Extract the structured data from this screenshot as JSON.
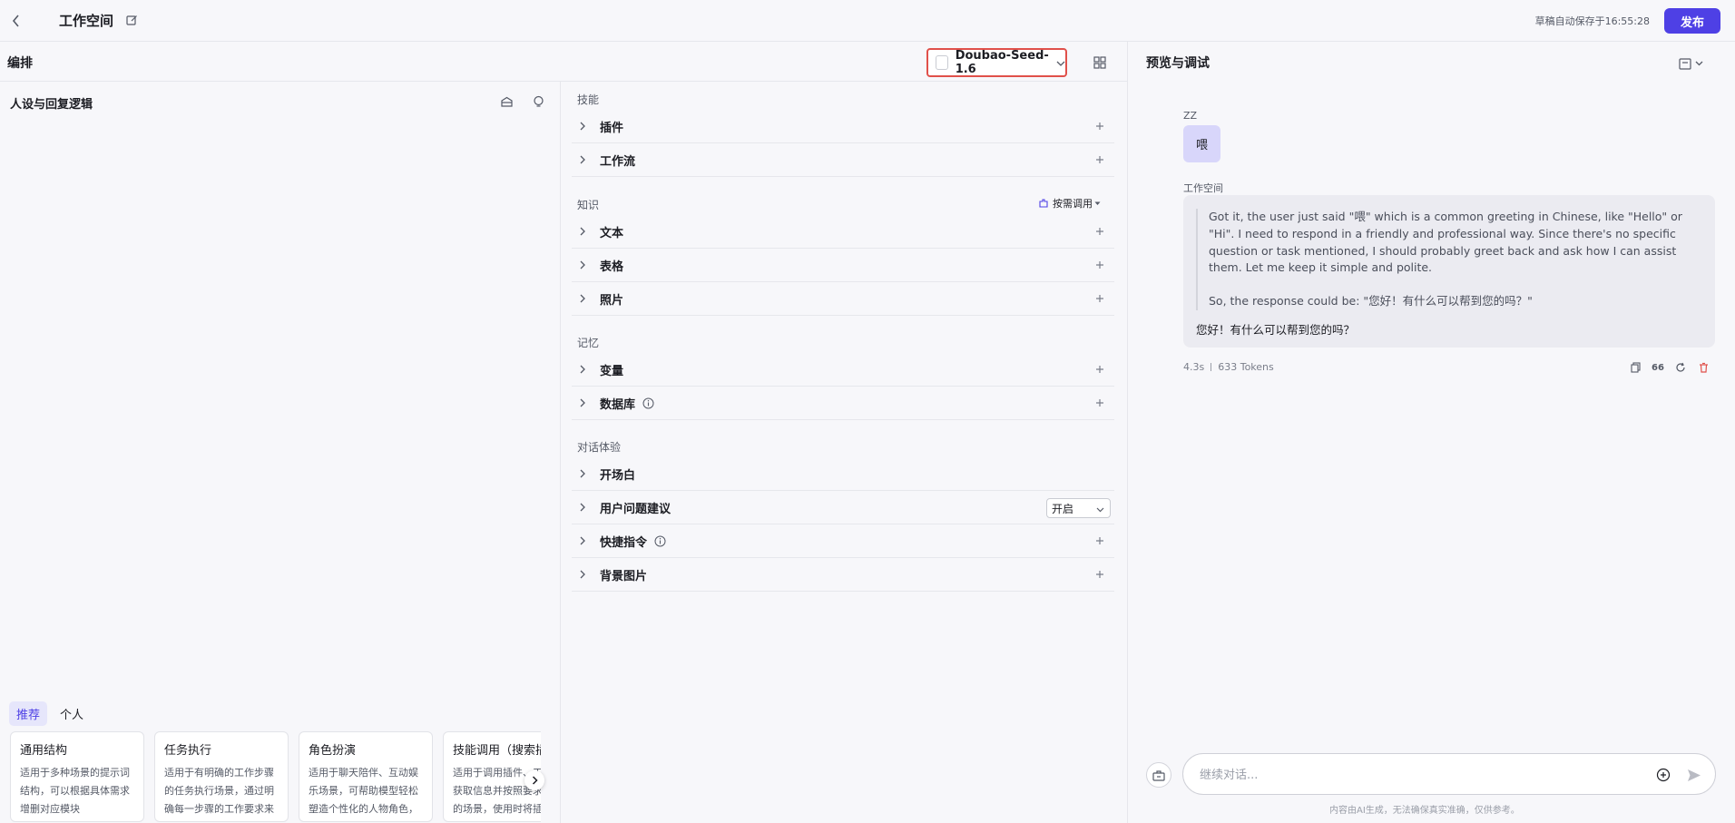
{
  "header": {
    "title": "工作空间",
    "autosave": "草稿自动保存于16:55:28",
    "publish_label": "发布"
  },
  "editor": {
    "title": "编排",
    "model_name": "Doubao-Seed-1.6"
  },
  "persona": {
    "title": "人设与回复逻辑"
  },
  "templates": {
    "tabs": [
      {
        "label": "推荐",
        "active": true
      },
      {
        "label": "个人",
        "active": false
      }
    ],
    "cards": [
      {
        "title": "通用结构",
        "desc": "适用于多种场景的提示词结构，可以根据具体需求增删对应模块"
      },
      {
        "title": "任务执行",
        "desc": "适用于有明确的工作步骤的任务执行场景，通过明确每一步骤的工作要求来指导模型完成复杂任务"
      },
      {
        "title": "角色扮演",
        "desc": "适用于聊天陪伴、互动娱乐场景，可帮助模型轻松塑造个性化的人物角色，生动演绎"
      },
      {
        "title": "技能调用（搜索插件）",
        "desc": "适用于调用插件、工作流获取信息并按照要求输出的场景，使用时将插件名称"
      }
    ]
  },
  "skills": {
    "section_skill": "技能",
    "plugin": "插件",
    "workflow": "工作流",
    "section_knowledge": "知识",
    "on_demand": "按需调用",
    "text": "文本",
    "table": "表格",
    "photo": "照片",
    "section_memory": "记忆",
    "variable": "变量",
    "database": "数据库",
    "section_chat": "对话体验",
    "opening": "开场白",
    "suggestion": "用户问题建议",
    "suggestion_value": "开启",
    "shortcut": "快捷指令",
    "background": "背景图片"
  },
  "preview": {
    "title": "预览与调试",
    "user_name": "ZZ",
    "user_message": "喂",
    "bot_name": "工作空间",
    "reasoning_1": "Got it, the user just said \"喂\" which is a common greeting in Chinese, like \"Hello\" or \"Hi\". I need to respond in a friendly and professional way. Since there's no specific question or task mentioned, I should probably greet back and ask how I can assist them. Let me keep it simple and polite.",
    "reasoning_2": "So, the response could be: \"您好！有什么可以帮到您的吗？\"",
    "answer": "您好！有什么可以帮到您的吗？",
    "latency": "4.3s",
    "tokens": "633 Tokens",
    "quote_label": "66",
    "input_placeholder": "继续对话...",
    "disclaimer": "内容由AI生成，无法确保真实准确，仅供参考。"
  },
  "colors": {
    "accent": "#4e40e5",
    "highlight_border": "#e0504a",
    "delete": "#e0504a"
  }
}
